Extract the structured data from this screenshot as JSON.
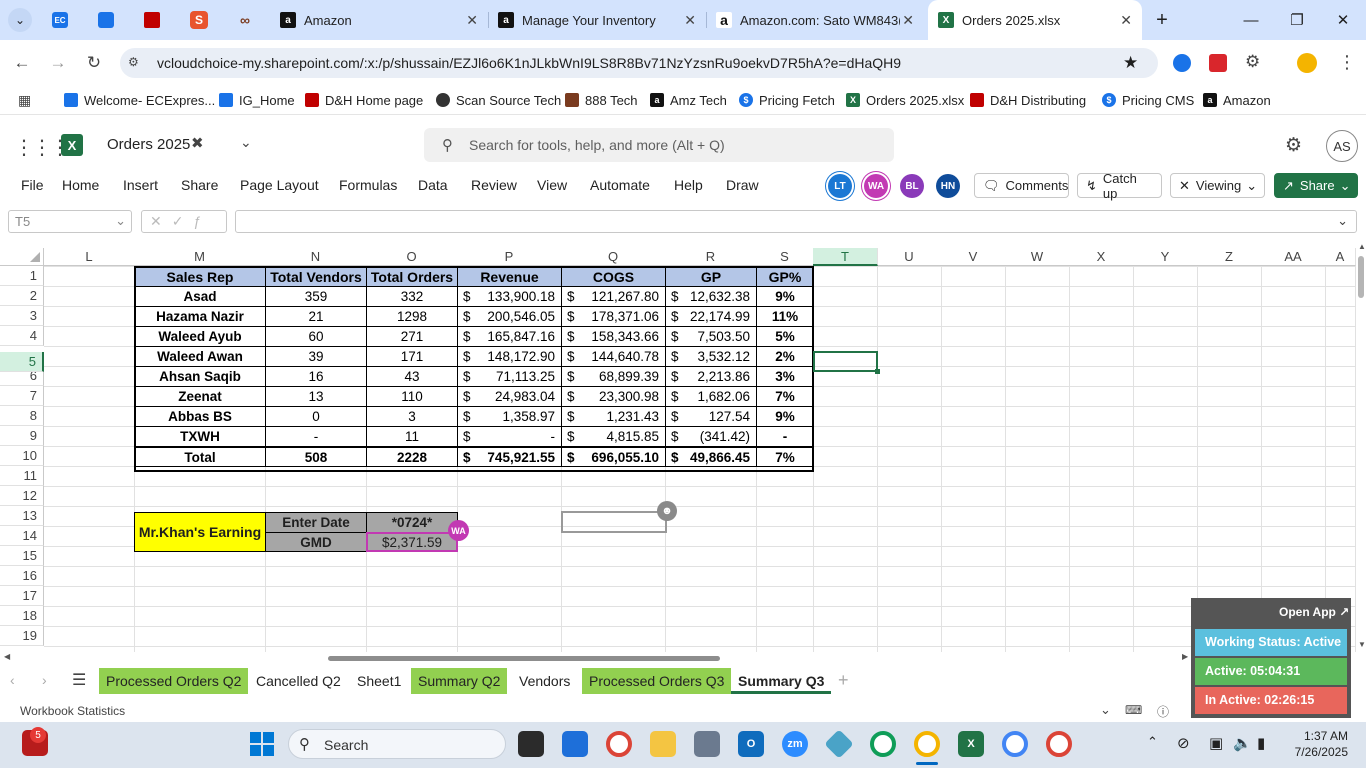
{
  "browser": {
    "tabs": [
      {
        "label": "Amazon",
        "icon": "amazon-icon",
        "active": false
      },
      {
        "label": "Manage Your Inventory",
        "icon": "amazon-icon",
        "active": false
      },
      {
        "label": "Amazon.com: Sato WM843(",
        "icon": "amazon-icon",
        "active": false
      },
      {
        "label": "Orders 2025.xlsx",
        "icon": "excel-icon",
        "active": true
      }
    ],
    "url": "vcloudchoice-my.sharepoint.com/:x:/p/shussain/EZJl6o6K1nJLkbWnI9LS8R8Bv71NzYzsnRu9oekvD7R5hA?e=dHaQH9",
    "bookmarks": [
      {
        "label": "Welcome- ECExpres...",
        "color": "#1a73e8"
      },
      {
        "label": "IG_Home",
        "color": "#1a73e8"
      },
      {
        "label": "D&H Home page",
        "color": "#c00000"
      },
      {
        "label": "Scan Source Tech",
        "color": "#333333"
      },
      {
        "label": "888 Tech",
        "color": "#7a3b1f"
      },
      {
        "label": "Amz Tech",
        "color": "#111111"
      },
      {
        "label": "Pricing Fetch",
        "color": "#1a73e8"
      },
      {
        "label": "Orders 2025.xlsx",
        "color": "#217346"
      },
      {
        "label": "D&H Distributing",
        "color": "#c00000"
      },
      {
        "label": "Pricing CMS",
        "color": "#1a73e8"
      },
      {
        "label": "Amazon",
        "color": "#111111"
      }
    ]
  },
  "excel": {
    "filename": "Orders 2025",
    "search_placeholder": "Search for tools, help, and more (Alt + Q)",
    "account": "AS",
    "ribbon_tabs": [
      "File",
      "Home",
      "Insert",
      "Share",
      "Page Layout",
      "Formulas",
      "Data",
      "Review",
      "View",
      "Automate",
      "Help",
      "Draw"
    ],
    "collaborators": [
      {
        "initials": "LT",
        "color": "#1b78d4"
      },
      {
        "initials": "WA",
        "color": "#c239b3"
      },
      {
        "initials": "BL",
        "color": "#8a3ab9"
      },
      {
        "initials": "HN",
        "color": "#0f4c9a"
      }
    ],
    "buttons": {
      "comments": "Comments",
      "catchup": "Catch up",
      "viewing": "Viewing",
      "share": "Share"
    },
    "name_box": "T5",
    "columns": [
      "L",
      "M",
      "N",
      "O",
      "P",
      "Q",
      "R",
      "S",
      "T",
      "U",
      "V",
      "W",
      "X",
      "Y",
      "Z",
      "AA",
      "A"
    ],
    "rows": [
      "1",
      "2",
      "3",
      "4",
      "5",
      "6",
      "7",
      "8",
      "9",
      "10",
      "11",
      "12",
      "13",
      "14",
      "15",
      "16",
      "17",
      "18",
      "19"
    ],
    "table_headers": [
      "Sales Rep",
      "Total Vendors",
      "Total Orders",
      "Revenue",
      "COGS",
      "GP",
      "GP%"
    ],
    "table_rows": [
      {
        "rep": "Asad",
        "vendors": "359",
        "orders": "332",
        "revenue": "133,900.18",
        "cogs": "121,267.80",
        "gp": "12,632.38",
        "gpp": "9%"
      },
      {
        "rep": "Hazama Nazir",
        "vendors": "21",
        "orders": "1298",
        "revenue": "200,546.05",
        "cogs": "178,371.06",
        "gp": "22,174.99",
        "gpp": "11%"
      },
      {
        "rep": "Waleed Ayub",
        "vendors": "60",
        "orders": "271",
        "revenue": "165,847.16",
        "cogs": "158,343.66",
        "gp": "7,503.50",
        "gpp": "5%"
      },
      {
        "rep": "Waleed Awan",
        "vendors": "39",
        "orders": "171",
        "revenue": "148,172.90",
        "cogs": "144,640.78",
        "gp": "3,532.12",
        "gpp": "2%"
      },
      {
        "rep": "Ahsan Saqib",
        "vendors": "16",
        "orders": "43",
        "revenue": "71,113.25",
        "cogs": "68,899.39",
        "gp": "2,213.86",
        "gpp": "3%"
      },
      {
        "rep": "Zeenat",
        "vendors": "13",
        "orders": "110",
        "revenue": "24,983.04",
        "cogs": "23,300.98",
        "gp": "1,682.06",
        "gpp": "7%"
      },
      {
        "rep": "Abbas BS",
        "vendors": "0",
        "orders": "3",
        "revenue": "1,358.97",
        "cogs": "1,231.43",
        "gp": "127.54",
        "gpp": "9%"
      },
      {
        "rep": "TXWH",
        "vendors": "-",
        "orders": "11",
        "revenue": "-",
        "cogs": "4,815.85",
        "gp": "(341.42)",
        "gpp": "-"
      }
    ],
    "total_row": {
      "rep": "Total",
      "vendors": "508",
      "orders": "2228",
      "revenue": "745,921.55",
      "cogs": "696,055.10",
      "gp": "49,866.45",
      "gpp": "7%"
    },
    "currency_symbol": "$",
    "earning": {
      "label": "Mr.Khan's Earning",
      "date_label": "Enter Date",
      "date_value": "*0724*",
      "gmd_label": "GMD",
      "gmd_value": "$2,371.59",
      "badge": "WA"
    },
    "sheet_tabs": [
      {
        "label": "Processed Orders Q2",
        "green": true,
        "active": false
      },
      {
        "label": "Cancelled Q2",
        "green": false,
        "active": false
      },
      {
        "label": "Sheet1",
        "green": false,
        "active": false
      },
      {
        "label": "Summary Q2",
        "green": true,
        "active": false
      },
      {
        "label": "Vendors",
        "green": false,
        "active": false
      },
      {
        "label": "Processed Orders Q3",
        "green": true,
        "active": false
      },
      {
        "label": "Summary Q3",
        "green": false,
        "active": true
      }
    ],
    "status_left": "Workbook Statistics"
  },
  "widget": {
    "open_app": "Open App",
    "working_status": "Working Status: Active",
    "active": "Active: 05:04:31",
    "inactive": "In Active: 02:26:15"
  },
  "taskbar": {
    "search": "Search",
    "time": "1:37 AM",
    "date": "7/26/2025",
    "notification_count": "5"
  }
}
